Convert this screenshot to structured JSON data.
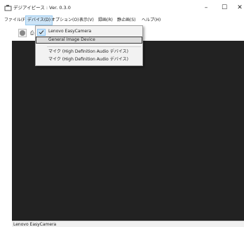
{
  "window": {
    "title": "デジアイピース : Ver. 0.3.0",
    "minimize": "–",
    "maximize": "☐",
    "close": "✕"
  },
  "menu": {
    "items": [
      {
        "label": "ファイル(F)",
        "active": false
      },
      {
        "label": "デバイス(D)",
        "active": true
      },
      {
        "label": "オプション(O)",
        "active": false
      },
      {
        "label": "表示(V)",
        "active": false
      },
      {
        "label": "録画(R)",
        "active": false
      },
      {
        "label": "静止画(S)",
        "active": false
      },
      {
        "label": "ヘルプ(H)",
        "active": false
      }
    ]
  },
  "device_menu": {
    "items": [
      {
        "label": "Lenovo EasyCamera",
        "checked": true
      },
      {
        "label": "General Image Device",
        "checked": false,
        "highlighted": true
      },
      {
        "label": "マイク (High Definition Audio デバイス)",
        "checked": false
      },
      {
        "label": "マイク (High Definition Audio デバイス)",
        "checked": false
      }
    ]
  },
  "toolbar": {
    "snapshot_glyph": "⎙"
  },
  "status": {
    "text": "Lenovo EasyCamera"
  },
  "colors": {
    "canvas": "#222222",
    "menu_active": "#cce4f7",
    "record_button": "#888888"
  }
}
